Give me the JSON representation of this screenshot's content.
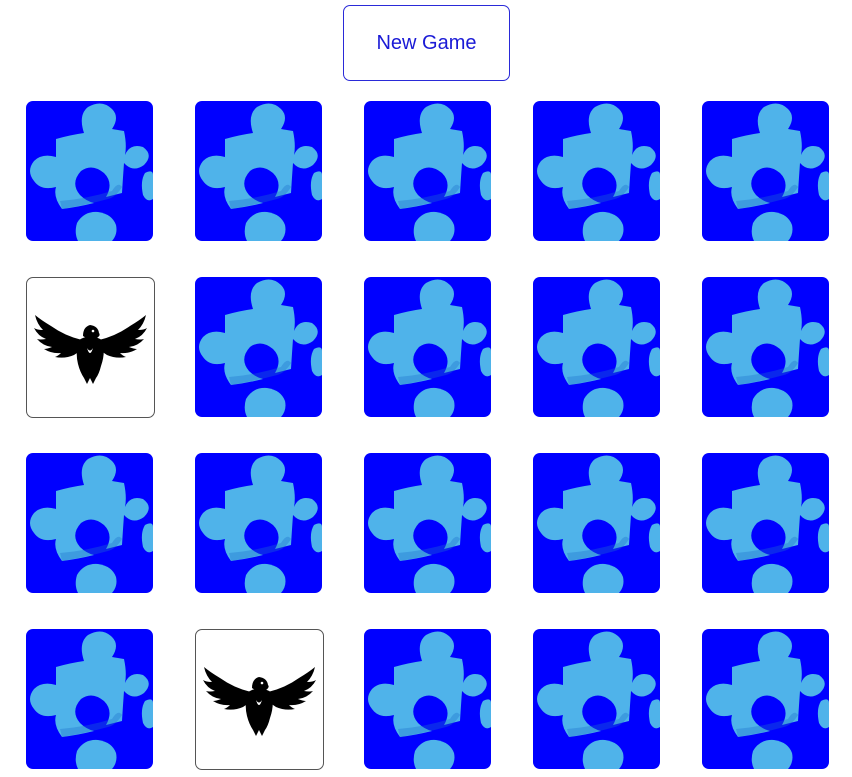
{
  "header": {
    "new_game_label": "New Game"
  },
  "colors": {
    "card_back": "#0000ff",
    "puzzle_piece": "#4fb3ea",
    "button_text": "#1a1ad6"
  },
  "board": {
    "rows": 4,
    "columns": 5,
    "cards": [
      {
        "state": "face-down",
        "icon": "puzzle-piece-icon"
      },
      {
        "state": "face-down",
        "icon": "puzzle-piece-icon"
      },
      {
        "state": "face-down",
        "icon": "puzzle-piece-icon"
      },
      {
        "state": "face-down",
        "icon": "puzzle-piece-icon"
      },
      {
        "state": "face-down",
        "icon": "puzzle-piece-icon"
      },
      {
        "state": "face-up",
        "icon": "eagle-icon"
      },
      {
        "state": "face-down",
        "icon": "puzzle-piece-icon"
      },
      {
        "state": "face-down",
        "icon": "puzzle-piece-icon"
      },
      {
        "state": "face-down",
        "icon": "puzzle-piece-icon"
      },
      {
        "state": "face-down",
        "icon": "puzzle-piece-icon"
      },
      {
        "state": "face-down",
        "icon": "puzzle-piece-icon"
      },
      {
        "state": "face-down",
        "icon": "puzzle-piece-icon"
      },
      {
        "state": "face-down",
        "icon": "puzzle-piece-icon"
      },
      {
        "state": "face-down",
        "icon": "puzzle-piece-icon"
      },
      {
        "state": "face-down",
        "icon": "puzzle-piece-icon"
      },
      {
        "state": "face-down",
        "icon": "puzzle-piece-icon"
      },
      {
        "state": "face-up",
        "icon": "eagle-icon"
      },
      {
        "state": "face-down",
        "icon": "puzzle-piece-icon"
      },
      {
        "state": "face-down",
        "icon": "puzzle-piece-icon"
      },
      {
        "state": "face-down",
        "icon": "puzzle-piece-icon"
      }
    ]
  }
}
